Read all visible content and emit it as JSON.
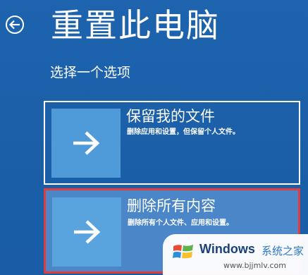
{
  "header": {
    "back_icon": "circle-back-arrow-icon",
    "title": "重置此电脑"
  },
  "prompt": "选择一个选项",
  "options": [
    {
      "title": "保留我的文件",
      "description": "删除应用和设置，但保留个人文件。",
      "icon": "right-arrow-icon"
    },
    {
      "title": "删除所有内容",
      "description": "删除所有个人文件、应用和设置。",
      "icon": "right-arrow-icon",
      "highlighted": true
    }
  ],
  "watermark": {
    "brand": "Windows",
    "tagline": "系统之家",
    "url": "www.bjjmlv.com"
  },
  "colors": {
    "background": "#1c5fa8",
    "tile": "#4f9ad9",
    "highlight_border": "#e23b3b"
  }
}
